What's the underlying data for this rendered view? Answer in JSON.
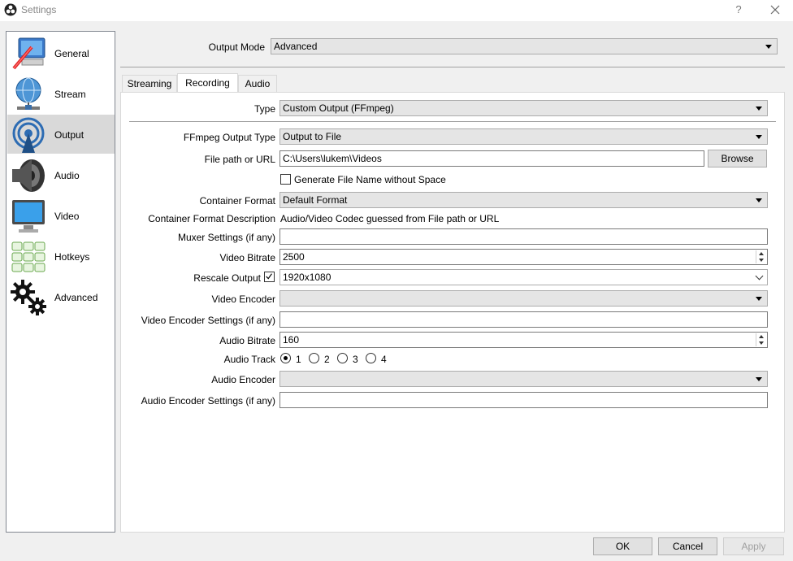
{
  "window": {
    "title": "Settings",
    "help": "?"
  },
  "sidebar": {
    "items": [
      {
        "label": "General",
        "icon": "general-icon"
      },
      {
        "label": "Stream",
        "icon": "stream-icon"
      },
      {
        "label": "Output",
        "icon": "output-icon",
        "active": true
      },
      {
        "label": "Audio",
        "icon": "audio-icon"
      },
      {
        "label": "Video",
        "icon": "video-icon"
      },
      {
        "label": "Hotkeys",
        "icon": "hotkeys-icon"
      },
      {
        "label": "Advanced",
        "icon": "advanced-icon"
      }
    ]
  },
  "output_mode": {
    "label": "Output Mode",
    "value": "Advanced"
  },
  "tabs": [
    {
      "label": "Streaming"
    },
    {
      "label": "Recording",
      "active": true
    },
    {
      "label": "Audio"
    }
  ],
  "recording": {
    "type": {
      "label": "Type",
      "value": "Custom Output (FFmpeg)"
    },
    "ffmpeg_output_type": {
      "label": "FFmpeg Output Type",
      "value": "Output to File"
    },
    "file_path": {
      "label": "File path or URL",
      "value": "C:\\Users\\lukem\\Videos",
      "browse": "Browse"
    },
    "gen_filename": {
      "label": "Generate File Name without Space",
      "checked": false
    },
    "container_format": {
      "label": "Container Format",
      "value": "Default Format"
    },
    "container_desc": {
      "label": "Container Format Description",
      "value": "Audio/Video Codec guessed from File path or URL"
    },
    "muxer_settings": {
      "label": "Muxer Settings (if any)",
      "value": ""
    },
    "video_bitrate": {
      "label": "Video Bitrate",
      "value": "2500"
    },
    "rescale_output": {
      "label": "Rescale Output",
      "checked": true,
      "value": "1920x1080"
    },
    "video_encoder": {
      "label": "Video Encoder",
      "value": ""
    },
    "video_encoder_settings": {
      "label": "Video Encoder Settings (if any)",
      "value": ""
    },
    "audio_bitrate": {
      "label": "Audio Bitrate",
      "value": "160"
    },
    "audio_track": {
      "label": "Audio Track",
      "options": [
        "1",
        "2",
        "3",
        "4"
      ],
      "selected": "1"
    },
    "audio_encoder": {
      "label": "Audio Encoder",
      "value": ""
    },
    "audio_encoder_settings": {
      "label": "Audio Encoder Settings (if any)",
      "value": ""
    }
  },
  "footer": {
    "ok": "OK",
    "cancel": "Cancel",
    "apply": "Apply"
  }
}
